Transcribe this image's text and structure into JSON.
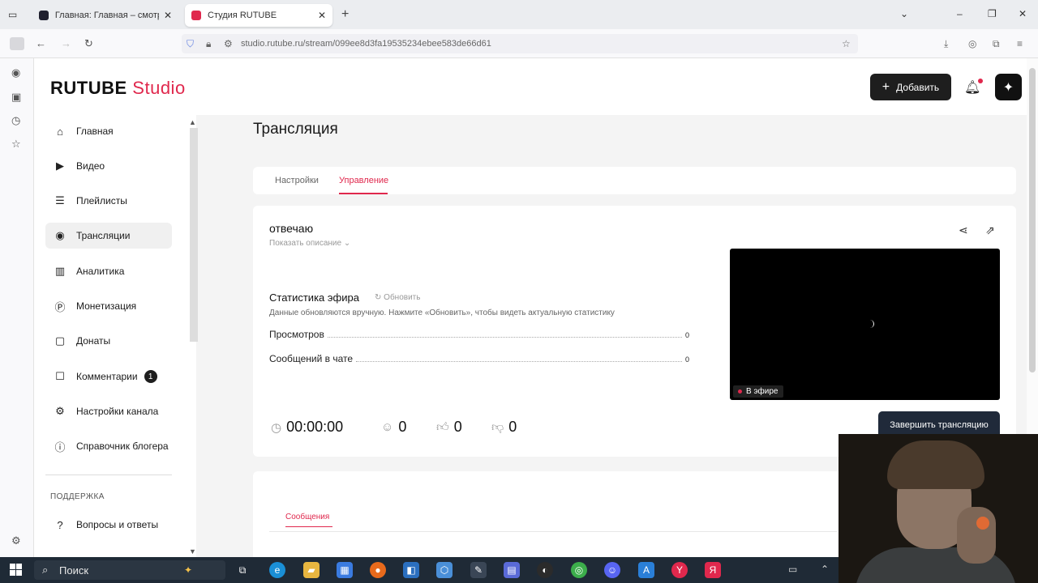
{
  "browser": {
    "tabs": [
      {
        "title": "Главная: Главная – смотреть онлайн",
        "active": false
      },
      {
        "title": "Студия RUTUBE",
        "active": true
      }
    ],
    "url": "studio.rutube.ru/stream/099ee8d3fa19535234ebee583de66d61"
  },
  "header": {
    "logo_main": "RUTUBE",
    "logo_studio": "Studio",
    "add_label": "Добавить"
  },
  "menu": {
    "items": [
      {
        "label": "Главная",
        "icon": "home-icon"
      },
      {
        "label": "Видео",
        "icon": "video-icon"
      },
      {
        "label": "Плейлисты",
        "icon": "playlist-icon"
      },
      {
        "label": "Трансляции",
        "icon": "broadcast-icon",
        "active": true
      },
      {
        "label": "Аналитика",
        "icon": "analytics-icon"
      },
      {
        "label": "Монетизация",
        "icon": "monetization-icon"
      },
      {
        "label": "Донаты",
        "icon": "donations-icon"
      },
      {
        "label": "Комментарии",
        "icon": "comments-icon",
        "badge": "1"
      },
      {
        "label": "Настройки канала",
        "icon": "settings-icon"
      },
      {
        "label": "Справочник блогера",
        "icon": "info-icon"
      }
    ],
    "support_heading": "ПОДДЕРЖКА",
    "faq_label": "Вопросы и ответы"
  },
  "main": {
    "title": "Трансляция",
    "tabs": [
      {
        "label": "Настройки",
        "active": false
      },
      {
        "label": "Управление",
        "active": true
      }
    ],
    "stream_title": "отвечаю",
    "show_description": "Показать описание",
    "stats": {
      "heading": "Статистика эфира",
      "refresh_label": "Обновить",
      "note": "Данные обновляются вручную. Нажмите «Обновить», чтобы видеть актуальную статистику",
      "views_label": "Просмотров",
      "views_value": "0",
      "chat_label": "Сообщений в чате",
      "chat_value": "0"
    },
    "live_badge": "В эфире",
    "metrics": {
      "duration": "00:00:00",
      "viewers": "0",
      "likes": "0",
      "dislikes": "0"
    },
    "end_button": "Завершить трансляцию",
    "messages_tab": "Сообщения"
  },
  "taskbar": {
    "search_placeholder": "Поиск"
  },
  "colors": {
    "accent": "#e0284d",
    "dark_button": "#1e1e1e",
    "taskbar": "#1f2a36"
  }
}
